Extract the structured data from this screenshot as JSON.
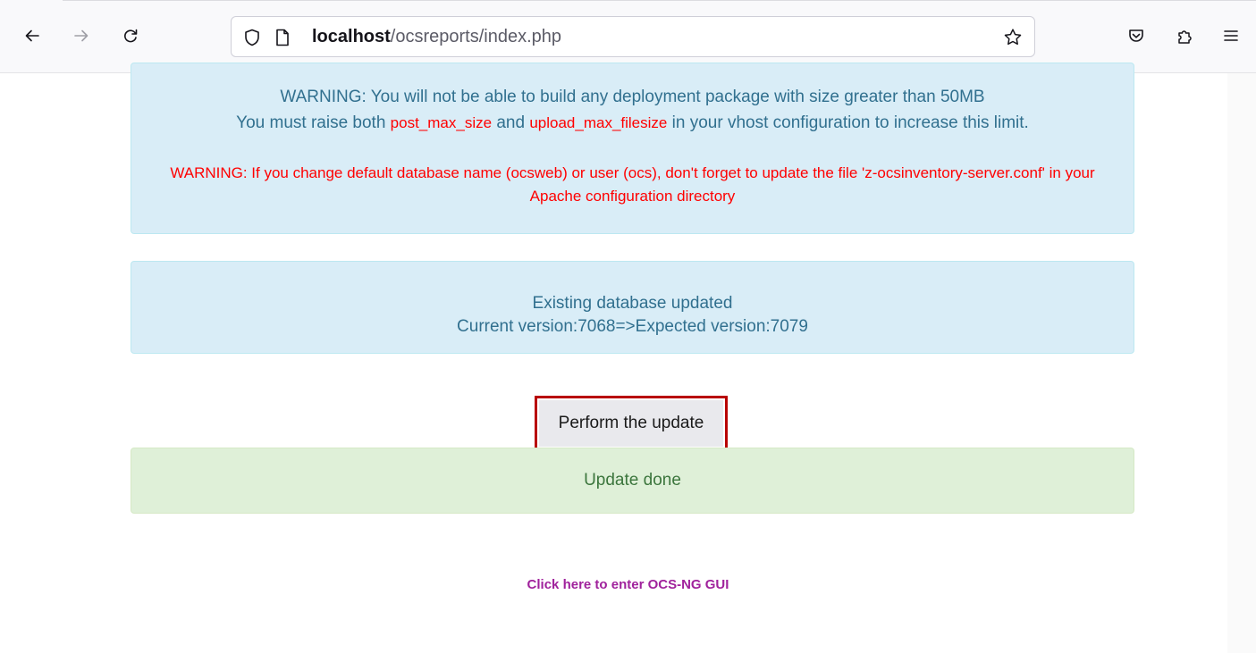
{
  "browser": {
    "url_host": "localhost",
    "url_path": "/ocsreports/index.php"
  },
  "alerts": {
    "limits": {
      "line1": "WARNING: You will not be able to build any deployment package with size greater than 50MB",
      "line2_prefix": "You must raise both ",
      "post_max_size": "post_max_size",
      "line2_and": " and ",
      "upload_max_filesize": "upload_max_filesize",
      "line2_suffix": " in your vhost configuration to increase this limit.",
      "warning2": "WARNING: If you change default database name (ocsweb) or user (ocs), don't forget to update the file 'z-ocsinventory-server.conf' in your Apache configuration directory"
    },
    "database": {
      "line1": "Existing database updated",
      "line2": "Current version:7068=>Expected version:7079"
    },
    "success": {
      "text": "Update done"
    }
  },
  "update_button": {
    "label": "Perform the update"
  },
  "enter_link": {
    "label": "Click here to enter OCS-NG GUI"
  },
  "colors": {
    "info_bg": "#d9edf7",
    "info_text": "#31708f",
    "success_bg": "#dff0d8",
    "success_text": "#3c763d",
    "warning_red": "#ff0000",
    "link": "#a0229c",
    "highlight_border": "#b80000"
  }
}
